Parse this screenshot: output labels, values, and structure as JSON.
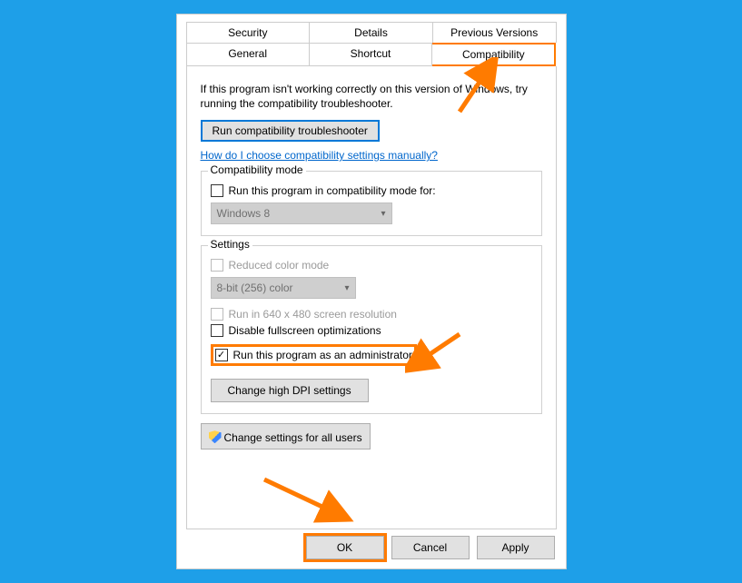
{
  "tabs_row1": [
    {
      "label": "Security"
    },
    {
      "label": "Details"
    },
    {
      "label": "Previous Versions"
    }
  ],
  "tabs_row2": [
    {
      "label": "General"
    },
    {
      "label": "Shortcut"
    },
    {
      "label": "Compatibility",
      "active": true
    }
  ],
  "intro": "If this program isn't working correctly on this version of Windows, try running the compatibility troubleshooter.",
  "troubleshooter_btn": "Run compatibility troubleshooter",
  "help_link": "How do I choose compatibility settings manually?",
  "compat_mode": {
    "title": "Compatibility mode",
    "checkbox_label": "Run this program in compatibility mode for:",
    "combo_value": "Windows 8"
  },
  "settings": {
    "title": "Settings",
    "reduced_color": "Reduced color mode",
    "color_combo": "8-bit (256) color",
    "run_640": "Run in 640 x 480 screen resolution",
    "disable_fs": "Disable fullscreen optimizations",
    "run_admin": "Run this program as an administrator",
    "dpi_btn": "Change high DPI settings"
  },
  "all_users_btn": "Change settings for all users",
  "buttons": {
    "ok": "OK",
    "cancel": "Cancel",
    "apply": "Apply"
  }
}
